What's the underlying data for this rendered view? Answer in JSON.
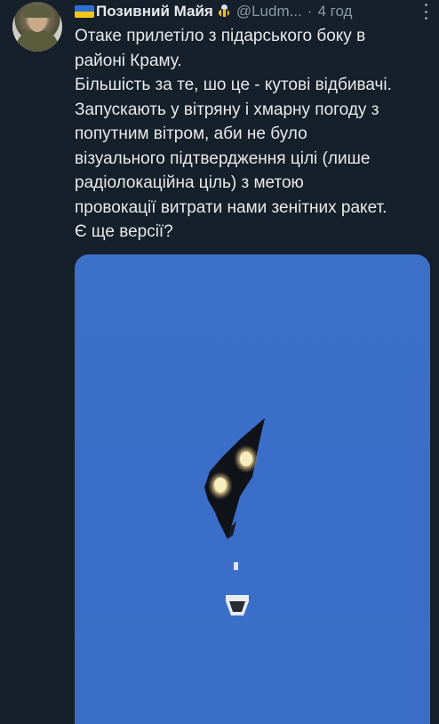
{
  "tweet": {
    "author_name": "Позивний Майя",
    "handle": "@Ludm...",
    "separator": "·",
    "time": "4 год",
    "text_lines": [
      "Отаке прилетіло з підарського боку в",
      "районі Краму.",
      "Більшість за те, шо це - кутові відбивачі.",
      "Запускають у вітряну і хмарну погоду з",
      "попутним вітром, аби не було",
      "візуального підтвердження цілі (лише",
      "радіолокаційна ціль) з метою",
      "провокації витрати нами зенітних ракет.",
      "Є ще версії?"
    ],
    "icons": {
      "flag": "ukraine-flag-icon",
      "emoji": "bee-icon",
      "more": "more-options-icon"
    },
    "colors": {
      "background": "#15202b",
      "text": "#e7e9ea",
      "secondary": "#8b98a5",
      "sky": "#3b6fc7"
    }
  }
}
